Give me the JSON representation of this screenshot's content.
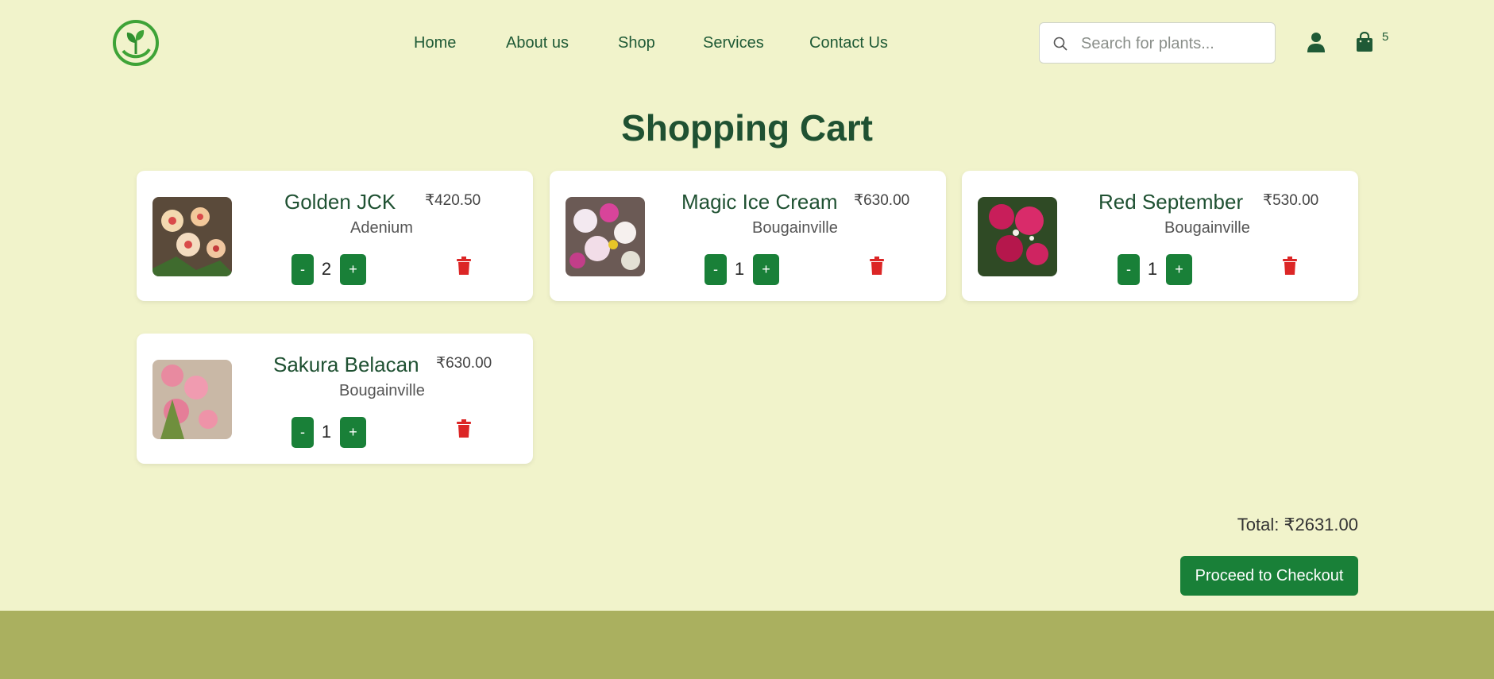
{
  "nav": {
    "links": [
      "Home",
      "About us",
      "Shop",
      "Services",
      "Contact Us"
    ]
  },
  "search": {
    "placeholder": "Search for plants..."
  },
  "cart_badge": "5",
  "page_title": "Shopping Cart",
  "cart": {
    "items": [
      {
        "name": "Golden JCK",
        "price": "₹420.50",
        "category": "Adenium",
        "qty": "2",
        "minus": "-",
        "plus": "+"
      },
      {
        "name": "Magic Ice Cream",
        "price": "₹630.00",
        "category": "Bougainville",
        "qty": "1",
        "minus": "-",
        "plus": "+"
      },
      {
        "name": "Red September",
        "price": "₹530.00",
        "category": "Bougainville",
        "qty": "1",
        "minus": "-",
        "plus": "+"
      },
      {
        "name": "Sakura Belacan",
        "price": "₹630.00",
        "category": "Bougainville",
        "qty": "1",
        "minus": "-",
        "plus": "+"
      }
    ],
    "total": "Total: ₹2631.00",
    "checkout_label": "Proceed to Checkout"
  },
  "colors": {
    "background": "#f1f3cb",
    "brand_green": "#198038",
    "heading_green": "#1f5132",
    "footer": "#aab05f",
    "delete_red": "#dc2626"
  },
  "icons": [
    "logo-leaf-icon",
    "search-icon",
    "user-icon",
    "shopping-bag-icon",
    "trash-icon"
  ]
}
